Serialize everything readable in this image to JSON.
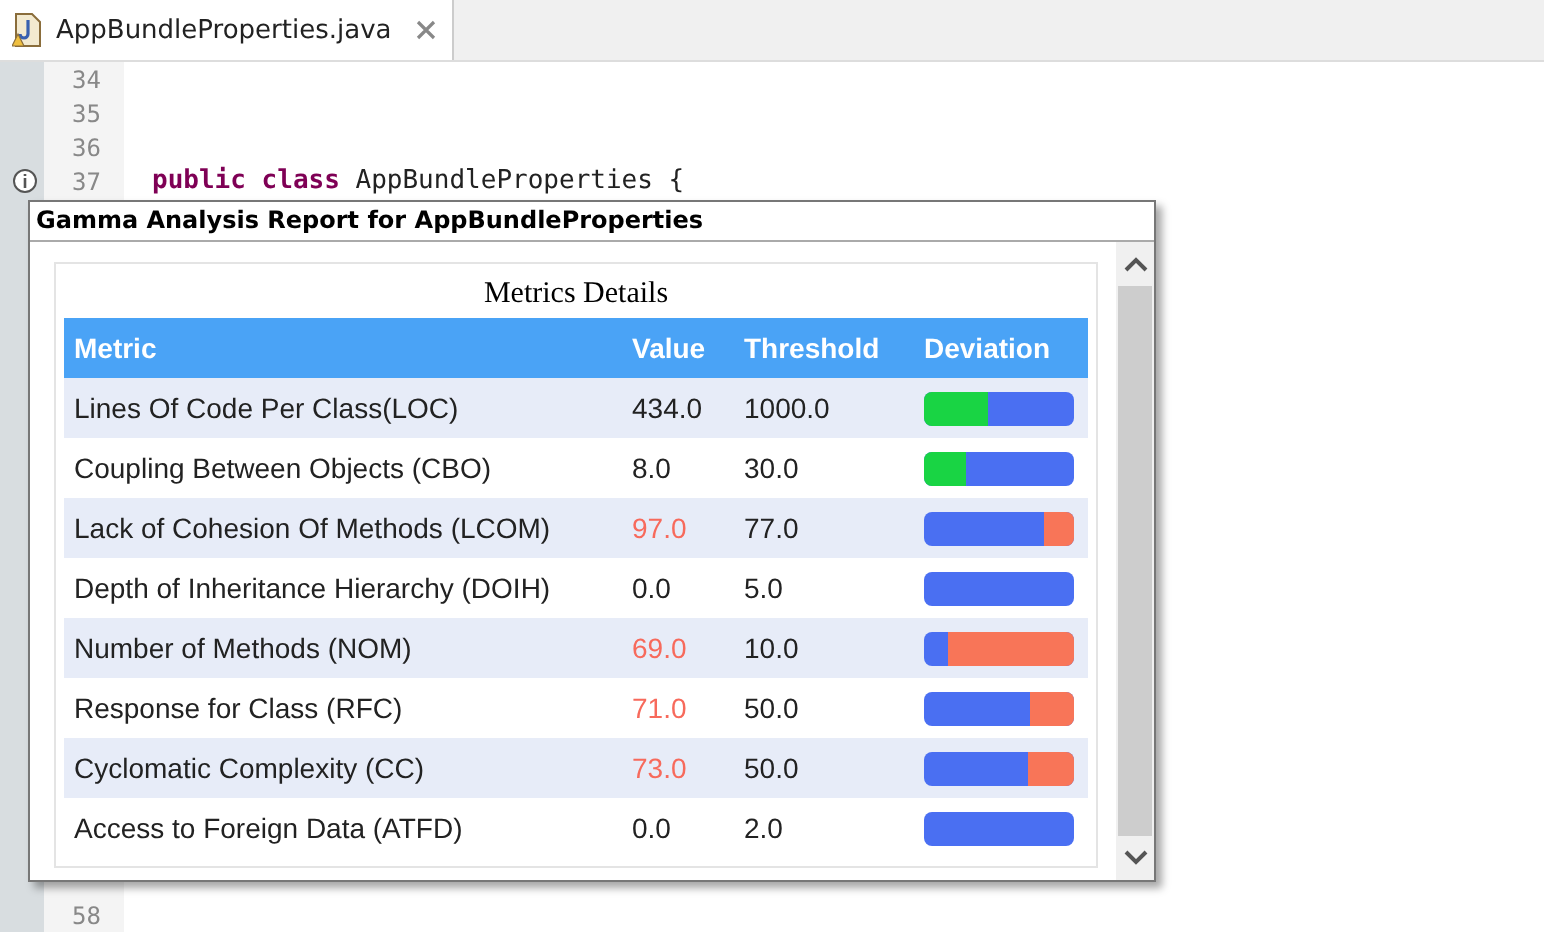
{
  "tab": {
    "label": "AppBundleProperties.java"
  },
  "editor": {
    "lines": [
      {
        "number": "34"
      },
      {
        "number": "35"
      },
      {
        "number": "36"
      },
      {
        "number": "37",
        "keyword": "public class",
        "code": " AppBundleProperties {"
      }
    ],
    "bottom_lines": [
      {
        "number": "58"
      }
    ]
  },
  "popup": {
    "title": "Gamma Analysis Report for AppBundleProperties",
    "table_title": "Metrics Details",
    "columns": [
      "Metric",
      "Value",
      "Threshold",
      "Deviation"
    ],
    "rows": [
      {
        "metric": "Lines Of Code Per Class(LOC)",
        "value": "434.0",
        "exceeded": false,
        "threshold": "1000.0",
        "deviation": {
          "kind": "under",
          "level": 0.43
        }
      },
      {
        "metric": "Coupling Between Objects (CBO)",
        "value": "8.0",
        "exceeded": false,
        "threshold": "30.0",
        "deviation": {
          "kind": "under",
          "level": 0.28
        }
      },
      {
        "metric": "Lack of Cohesion Of Methods (LCOM)",
        "value": "97.0",
        "exceeded": true,
        "threshold": "77.0",
        "deviation": {
          "kind": "over",
          "level": 0.2
        }
      },
      {
        "metric": "Depth of Inheritance Hierarchy (DOIH)",
        "value": "0.0",
        "exceeded": false,
        "threshold": "5.0",
        "deviation": {
          "kind": "none"
        }
      },
      {
        "metric": "Number of Methods (NOM)",
        "value": "69.0",
        "exceeded": true,
        "threshold": "10.0",
        "deviation": {
          "kind": "over",
          "level": 0.84
        }
      },
      {
        "metric": "Response for Class (RFC)",
        "value": "71.0",
        "exceeded": true,
        "threshold": "50.0",
        "deviation": {
          "kind": "over",
          "level": 0.29
        }
      },
      {
        "metric": "Cyclomatic Complexity (CC)",
        "value": "73.0",
        "exceeded": true,
        "threshold": "50.0",
        "deviation": {
          "kind": "over",
          "level": 0.31
        }
      },
      {
        "metric": "Access to Foreign Data (ATFD)",
        "value": "0.0",
        "exceeded": false,
        "threshold": "2.0",
        "deviation": {
          "kind": "none"
        }
      }
    ]
  }
}
